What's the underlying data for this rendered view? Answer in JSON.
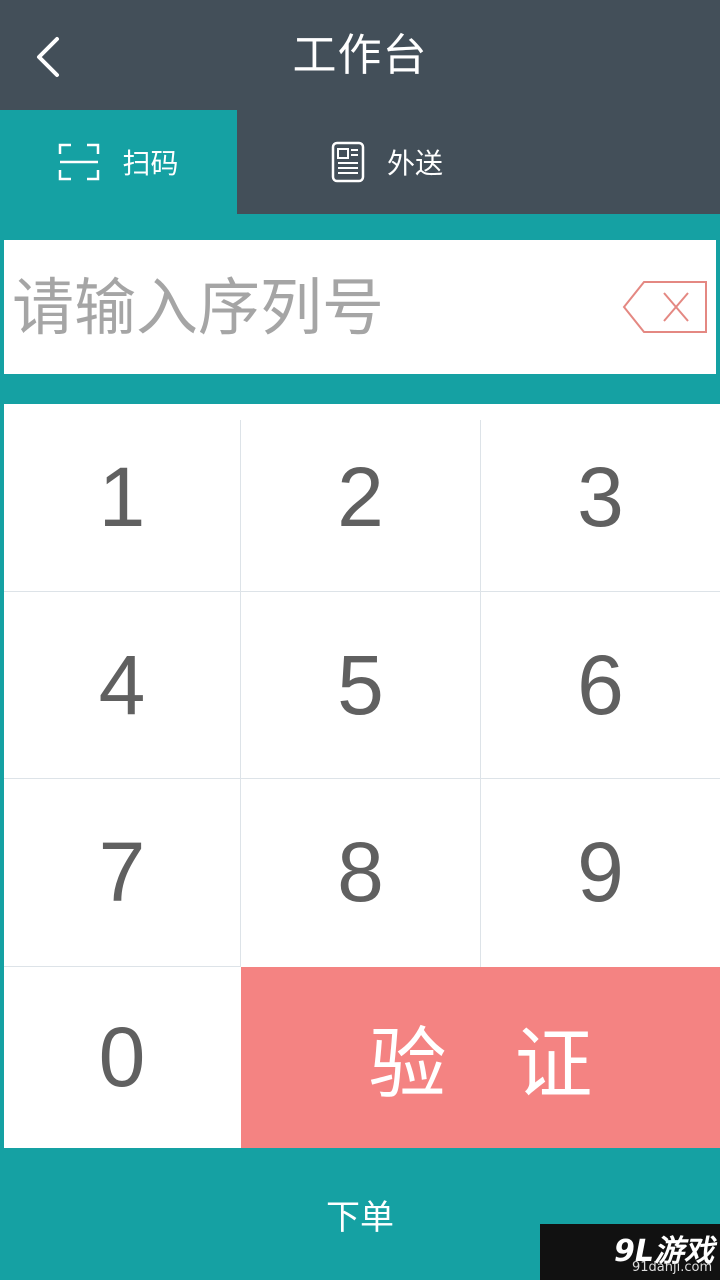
{
  "header": {
    "title": "工作台",
    "back_icon": "chevron-left-icon"
  },
  "tabs": [
    {
      "label": "扫码",
      "icon": "scan-icon",
      "active": true
    },
    {
      "label": "外送",
      "icon": "document-icon",
      "active": false
    }
  ],
  "input": {
    "value": "",
    "placeholder": "请输入序列号",
    "clear_icon": "backspace-icon"
  },
  "keypad": {
    "keys": [
      "1",
      "2",
      "3",
      "4",
      "5",
      "6",
      "7",
      "8",
      "9",
      "0"
    ],
    "verify_label": "验证"
  },
  "footer": {
    "order_label": "下单"
  },
  "watermark": {
    "logo": "9L游戏",
    "site": "91danji.com"
  },
  "colors": {
    "header_bg": "#434f59",
    "accent_teal": "#15a1a3",
    "verify_bg": "#f48382",
    "key_text": "#606060",
    "placeholder": "#a5a5a5"
  }
}
